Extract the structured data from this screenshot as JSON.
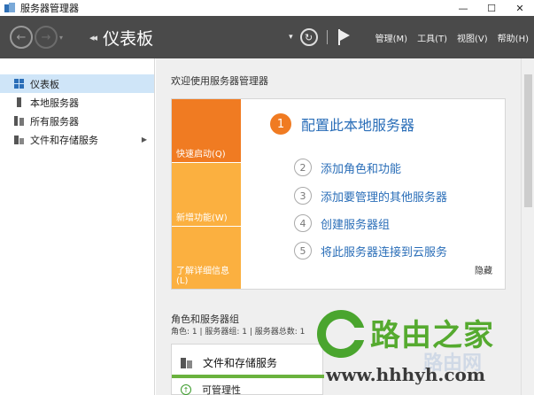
{
  "window": {
    "title": "服务器管理器",
    "min_glyph": "—",
    "max_glyph": "☐",
    "close_glyph": "✕"
  },
  "toolbar": {
    "back_glyph": "←",
    "forward_glyph": "→",
    "breadcrumb_glyph": "◂◂",
    "page_title": "仪表板",
    "menu": [
      "管理(M)",
      "工具(T)",
      "视图(V)",
      "帮助(H)"
    ]
  },
  "sidebar": {
    "items": [
      {
        "label": "仪表板",
        "icon": "dashboard-icon",
        "active": true
      },
      {
        "label": "本地服务器",
        "icon": "server-icon"
      },
      {
        "label": "所有服务器",
        "icon": "servers-icon"
      },
      {
        "label": "文件和存储服务",
        "icon": "storage-icon",
        "has_submenu": true
      }
    ]
  },
  "welcome": {
    "title": "欢迎使用服务器管理器",
    "tiles": [
      "快速启动(Q)",
      "新增功能(W)",
      "了解详细信息(L)"
    ],
    "steps": [
      {
        "num": "1",
        "text": "配置此本地服务器"
      },
      {
        "num": "2",
        "text": "添加角色和功能"
      },
      {
        "num": "3",
        "text": "添加要管理的其他服务器"
      },
      {
        "num": "4",
        "text": "创建服务器组"
      },
      {
        "num": "5",
        "text": "将此服务器连接到云服务"
      }
    ],
    "hide_label": "隐藏"
  },
  "roles": {
    "title": "角色和服务器组",
    "counts": "角色: 1 | 服务器组: 1 | 服务器总数: 1",
    "card": {
      "title": "文件和存储服务",
      "status": "可管理性",
      "status_color": "#6ab23e"
    }
  },
  "watermark": {
    "brand": "路由之家",
    "url": "www.hhhyh.com",
    "faint": "路由网"
  },
  "colors": {
    "accent_orange": "#f07b22",
    "tile_yellow": "#fbb040",
    "link_blue": "#2a6eb8",
    "toolbar_bg": "#4a4a4a"
  }
}
